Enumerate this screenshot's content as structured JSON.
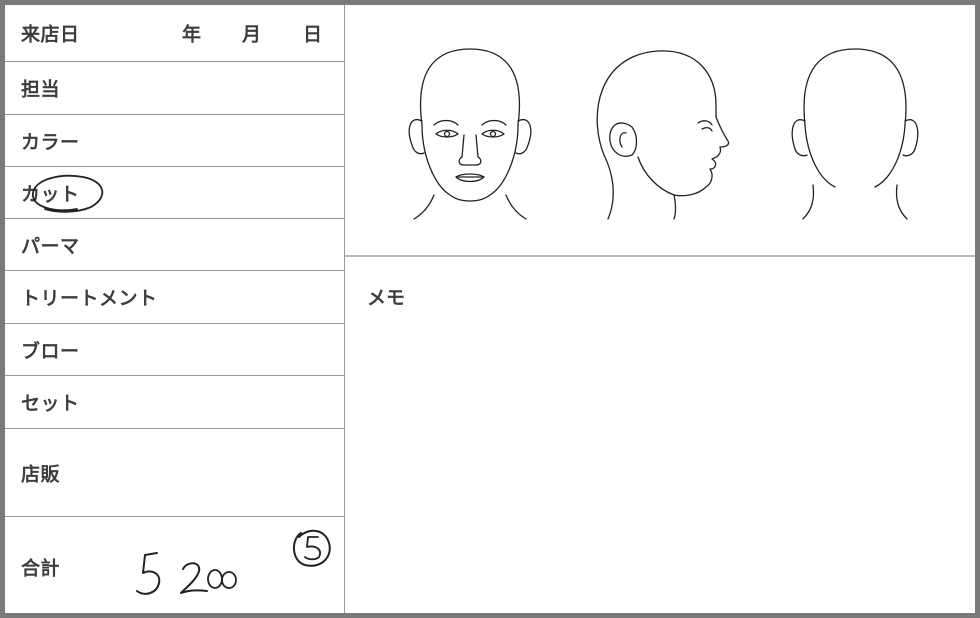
{
  "header": {
    "visit_date_label": "来店日",
    "year_label": "年",
    "month_label": "月",
    "day_label": "日"
  },
  "rows": {
    "staff": "担当",
    "color": "カラー",
    "cut": "カット",
    "perm": "パーマ",
    "treatment": "トリートメント",
    "blow": "ブロー",
    "set": "セット",
    "retail": "店販",
    "total": "合計"
  },
  "handwriting": {
    "total_amount": "5200",
    "circled_mark": "5"
  },
  "memo": {
    "label": "メモ"
  },
  "icons": {
    "head_front": "head-front-illustration",
    "head_side": "head-side-illustration",
    "head_back": "head-back-illustration"
  },
  "colors": {
    "frame": "#7a7a7a",
    "rule": "#9a9a9a",
    "text": "#3d3d3d",
    "ink": "#222222"
  }
}
